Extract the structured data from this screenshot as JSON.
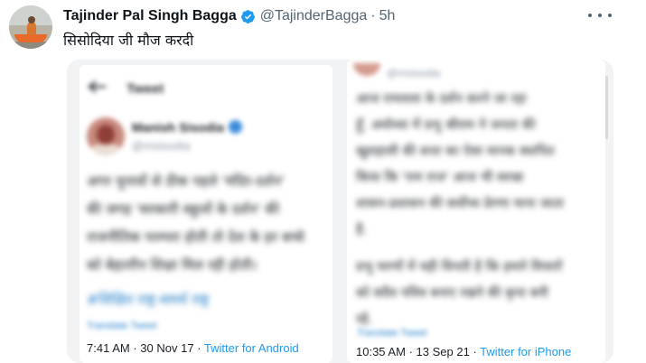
{
  "tweet": {
    "author_name": "Tajinder Pal Singh Bagga",
    "handle": "@TajinderBagga",
    "separator": "·",
    "time_ago": "5h",
    "text": "सिसोदिया जी मौज करदी"
  },
  "icons": {
    "verified": "verified-badge-icon",
    "more": "more-options-icon",
    "back": "back-arrow-icon"
  },
  "colors": {
    "verified_blue": "#1d9bf0",
    "link_blue": "#1d9bf0",
    "secondary_text": "#536471"
  },
  "media": {
    "left": {
      "header_title": "Tweet",
      "author_name": "Manish Sisodia",
      "author_handle": "@msisodia",
      "body_lines": [
        "अगर चुनावों से ठीक पहले 'मंदिर-दर्शन'",
        "की जगह 'सरकारी स्कूलों के दर्शन' की",
        "राजनीतिक परम्परा होती तो देश के हर बच्चे",
        "को बेहतरीन शिक्षा मिल रही होती।"
      ],
      "hashtags": "#शिक्षित राष्ट्र-समर्थ राष्ट्र",
      "translate_label": "Translate Tweet",
      "time": "7:41 AM",
      "separator": "·",
      "date": "30 Nov 17",
      "client": "Twitter for Android"
    },
    "right": {
      "author_handle": "@msisodia",
      "body_lines": [
        "आज रामलला के दर्शन करने जा रहा",
        "हूँ. अयोध्या में प्रभु श्रीराम ने जनता की",
        "खुशहाली की सत्ता का ऐसा मानक स्थापित",
        "किया कि 'राम राज' आज भी स्वच्छ",
        "शासन-प्रशासन की सर्वोच्च प्रेरणा माना जाता",
        "है."
      ],
      "body_lines_2": [
        "प्रभु चरणों में यही विनती है कि हमारे विचारों",
        "को सदैव पवित्र बनाए रखने की कृपा बनी",
        "रहे."
      ],
      "translate_label": "Translate Tweet",
      "time": "10:35 AM",
      "separator": "·",
      "date": "13 Sep 21",
      "client": "Twitter for iPhone"
    }
  }
}
